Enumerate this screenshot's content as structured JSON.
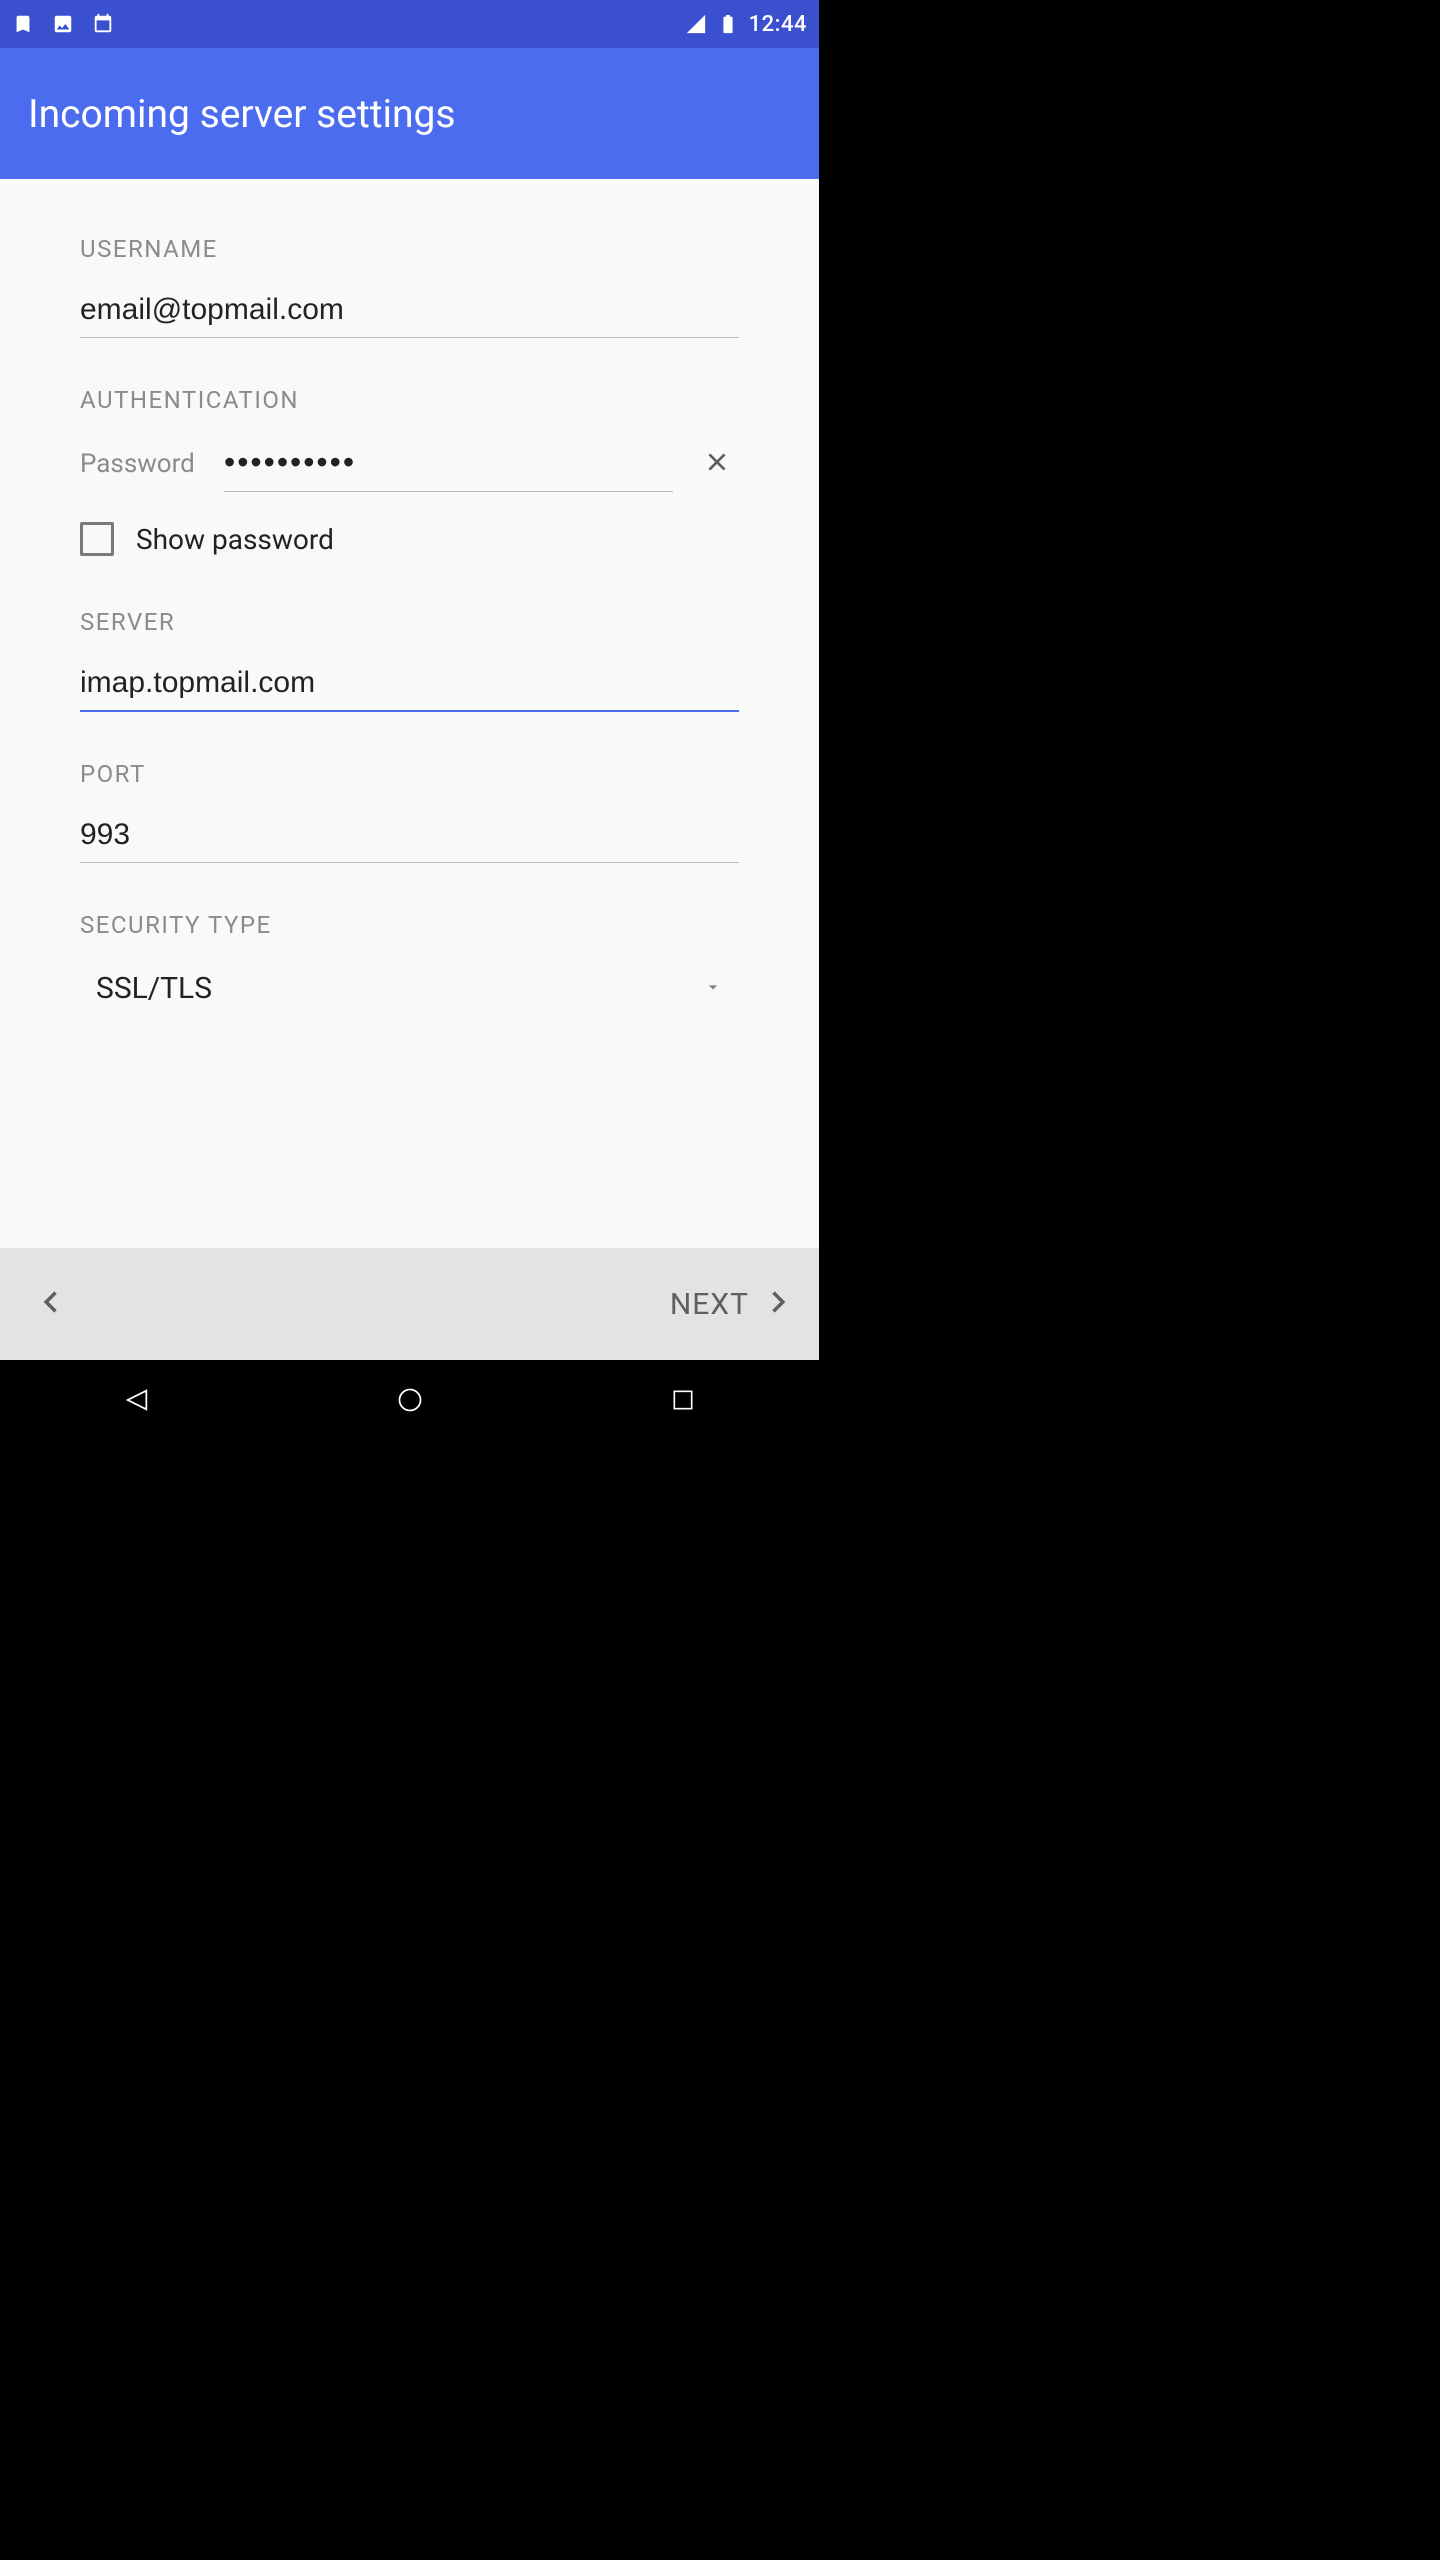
{
  "status_bar": {
    "time": "12:44"
  },
  "app_bar": {
    "title": "Incoming server settings"
  },
  "fields": {
    "username": {
      "label": "USERNAME",
      "value": "email@topmail.com"
    },
    "authentication": {
      "label": "AUTHENTICATION",
      "password_label": "Password",
      "password_value": "••••••••••",
      "show_password_label": "Show password"
    },
    "server": {
      "label": "SERVER",
      "value": "imap.topmail.com"
    },
    "port": {
      "label": "PORT",
      "value": "993"
    },
    "security": {
      "label": "SECURITY TYPE",
      "value": "SSL/TLS"
    }
  },
  "footer": {
    "next_label": "NEXT"
  }
}
